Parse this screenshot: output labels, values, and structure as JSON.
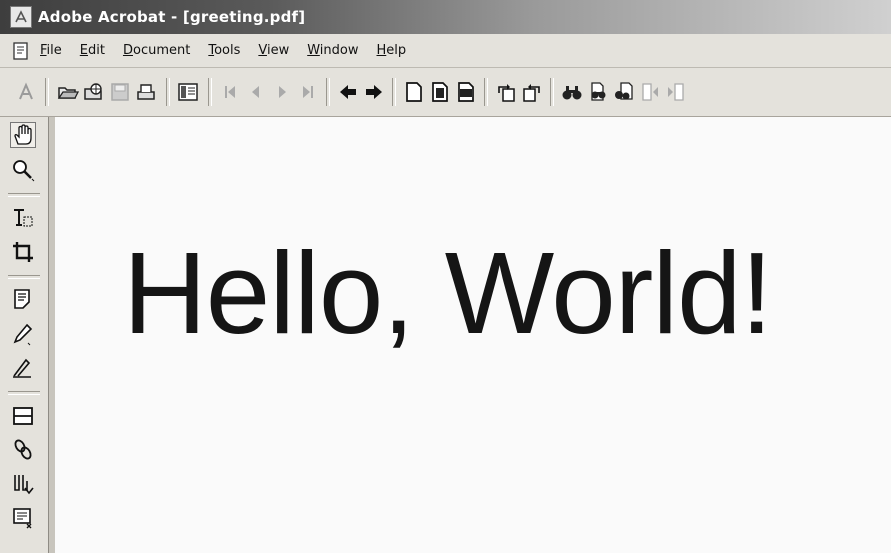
{
  "window": {
    "title": "Adobe Acrobat - [greeting.pdf]"
  },
  "menubar": {
    "items": [
      {
        "prefix": "",
        "accel": "F",
        "rest": "ile"
      },
      {
        "prefix": "",
        "accel": "E",
        "rest": "dit"
      },
      {
        "prefix": "",
        "accel": "D",
        "rest": "ocument"
      },
      {
        "prefix": "",
        "accel": "T",
        "rest": "ools"
      },
      {
        "prefix": "",
        "accel": "V",
        "rest": "iew"
      },
      {
        "prefix": "",
        "accel": "W",
        "rest": "indow"
      },
      {
        "prefix": "",
        "accel": "H",
        "rest": "elp"
      }
    ]
  },
  "toolbar": {
    "icons": [
      "acrobat-logo-icon",
      "open-icon",
      "open-web-icon",
      "save-icon",
      "print-icon",
      "show-hide-navigation-icon",
      "first-page-icon",
      "previous-page-icon",
      "next-page-icon",
      "last-page-icon",
      "go-back-icon",
      "go-forward-icon",
      "actual-size-icon",
      "fit-page-icon",
      "fit-width-icon",
      "rotate-left-icon",
      "rotate-right-icon",
      "find-icon",
      "search-icon",
      "search-results-icon",
      "previous-highlight-icon",
      "next-highlight-icon"
    ]
  },
  "tools": {
    "icons": [
      "hand-tool-icon",
      "zoom-tool-icon",
      "text-select-tool-icon",
      "crop-tool-icon",
      "notes-tool-icon",
      "pencil-tool-icon",
      "highlight-tool-icon",
      "form-tool-icon",
      "link-tool-icon",
      "article-tool-icon",
      "movie-tool-icon"
    ]
  },
  "document": {
    "text": "Hello, World!"
  },
  "colors": {
    "titlebar_dark": "#3e3e3e",
    "chrome": "#e4e2dc",
    "page": "#fafafa",
    "text": "#151515"
  }
}
